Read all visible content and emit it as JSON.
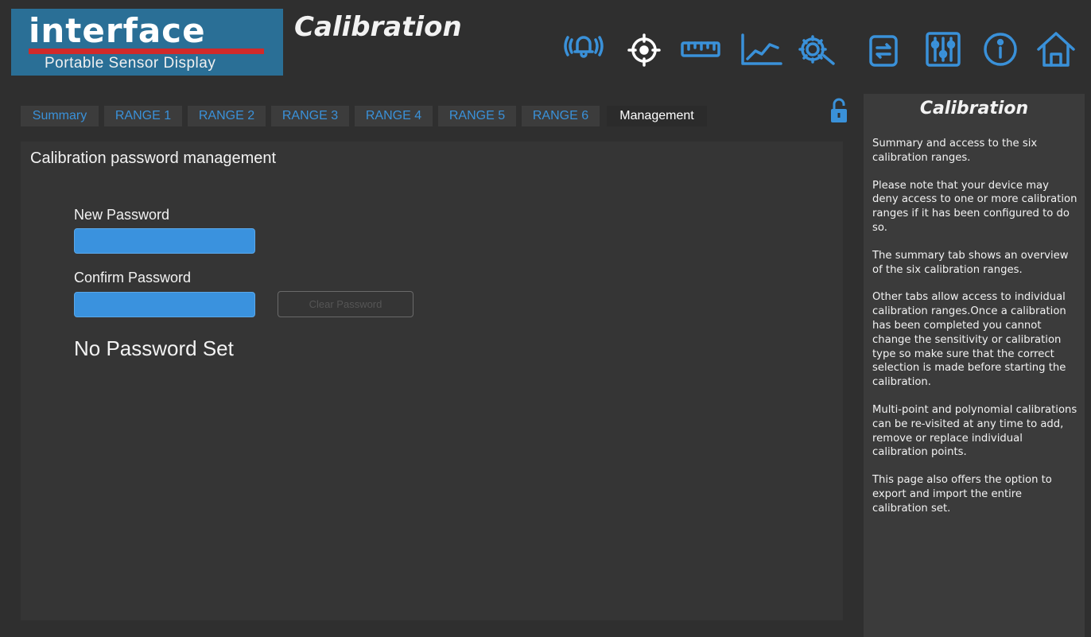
{
  "logo": {
    "word": "interface",
    "subtitle": "Portable Sensor Display"
  },
  "page_title": "Calibration",
  "toolbar": {
    "icons": [
      {
        "name": "alarm-bell-icon",
        "color": "#3a91d9"
      },
      {
        "name": "target-crosshair-icon",
        "color": "#ffffff"
      },
      {
        "name": "ruler-icon",
        "color": "#3a91d9"
      },
      {
        "name": "line-chart-icon",
        "color": "#3a91d9"
      },
      {
        "name": "gear-wrench-icon",
        "color": "#3a91d9"
      },
      {
        "name": "file-transfer-icon",
        "color": "#3a91d9"
      },
      {
        "name": "sliders-icon",
        "color": "#3a91d9"
      },
      {
        "name": "info-icon",
        "color": "#3a91d9"
      },
      {
        "name": "home-icon",
        "color": "#3a91d9"
      }
    ]
  },
  "tabs": [
    {
      "label": "Summary",
      "active": false
    },
    {
      "label": "RANGE 1",
      "active": false
    },
    {
      "label": "RANGE 2",
      "active": false
    },
    {
      "label": "RANGE 3",
      "active": false
    },
    {
      "label": "RANGE 4",
      "active": false
    },
    {
      "label": "RANGE 5",
      "active": false
    },
    {
      "label": "RANGE 6",
      "active": false
    },
    {
      "label": "Management",
      "active": true
    }
  ],
  "management": {
    "heading": "Calibration password management",
    "new_password_label": "New Password",
    "new_password_value": "",
    "confirm_password_label": "Confirm Password",
    "confirm_password_value": "",
    "clear_button_label": "Clear Password",
    "status": "No Password Set"
  },
  "help": {
    "title": "Calibration",
    "paragraphs": [
      "Summary and access to the six calibration ranges.",
      "Please note that your device may deny access to one or more calibration ranges if it has been configured to do so.",
      "The summary tab shows an overview of the six calibration ranges.",
      "Other tabs allow access to individual calibration ranges.Once a calibration has been completed you cannot change the sensitivity or calibration type so make sure that the correct selection is made before starting the calibration.",
      "Multi-point and polynomial calibrations can be re-visited at any time to add, remove or replace individual calibration points.",
      "This page also offers the option to export and import the entire calibration set."
    ]
  },
  "colors": {
    "accent": "#3a91d9",
    "logo_bg": "#2a6f96",
    "logo_bar": "#d12a2a",
    "background": "#2f2f2f"
  }
}
